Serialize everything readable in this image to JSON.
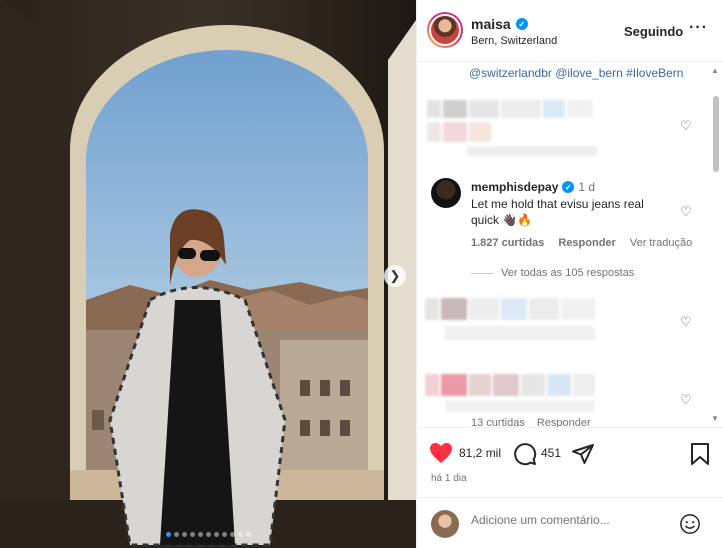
{
  "post": {
    "username": "maisa",
    "location": "Bern, Switzerland",
    "follow_label": "Seguindo",
    "more_label": "···",
    "next_icon": "chevron-right-icon",
    "carousel_count": 11,
    "carousel_active": 1
  },
  "caption": {
    "mentions": "@switzerlandbr @ilove_bern #IloveBern"
  },
  "comment": {
    "username": "memphisdepay",
    "time": "1 d",
    "text": "Let me hold that evisu jeans real quick 👋🏿🔥",
    "likes": "1.827 curtidas",
    "reply_label": "Responder",
    "translate_label": "Ver tradução",
    "view_replies": "Ver todas as 105 respostas"
  },
  "blurred_comment": {
    "likes": "13 curtidas",
    "reply_label": "Responder"
  },
  "actions": {
    "likes": "81,2 mil",
    "comments": "451",
    "time_ago": "há 1 dia"
  },
  "composer": {
    "placeholder": "Adicione um comentário..."
  },
  "colors": {
    "like_red": "#ff3040",
    "verified_blue": "#0095f6",
    "link_blue": "#3b67a3"
  }
}
